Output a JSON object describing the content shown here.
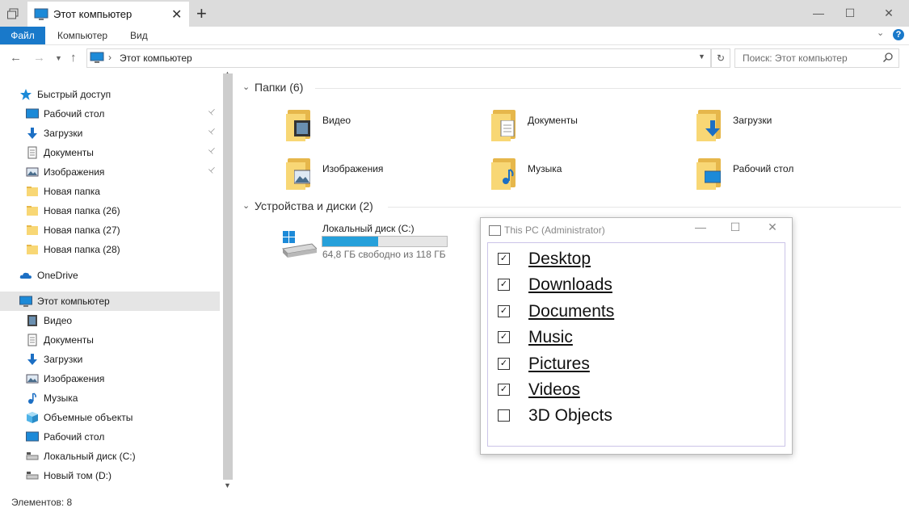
{
  "window": {
    "tab_title": "Этот компьютер",
    "new_tab": "+",
    "minimize": "—",
    "maximize": "☐",
    "close": "✕"
  },
  "ribbon": {
    "file": "Файл",
    "computer": "Компьютер",
    "view": "Вид",
    "help": "?",
    "collapse": "⌄"
  },
  "address": {
    "path": "Этот компьютер",
    "separator": "›",
    "search_placeholder": "Поиск: Этот компьютер"
  },
  "nav_pane": {
    "quick_access": "Быстрый доступ",
    "quick_items": [
      {
        "label": "Рабочий стол",
        "icon": "desktop-icon",
        "pinned": true
      },
      {
        "label": "Загрузки",
        "icon": "downloads-icon",
        "pinned": true
      },
      {
        "label": "Документы",
        "icon": "documents-icon",
        "pinned": true
      },
      {
        "label": "Изображения",
        "icon": "pictures-icon",
        "pinned": true
      },
      {
        "label": "Новая папка",
        "icon": "folder-icon",
        "pinned": false
      },
      {
        "label": "Новая папка (26)",
        "icon": "folder-icon",
        "pinned": false
      },
      {
        "label": "Новая папка (27)",
        "icon": "folder-icon",
        "pinned": false
      },
      {
        "label": "Новая папка (28)",
        "icon": "folder-icon",
        "pinned": false
      }
    ],
    "onedrive": "OneDrive",
    "this_pc": "Этот компьютер",
    "pc_items": [
      {
        "label": "Видео",
        "icon": "video-icon"
      },
      {
        "label": "Документы",
        "icon": "documents-icon"
      },
      {
        "label": "Загрузки",
        "icon": "downloads-icon"
      },
      {
        "label": "Изображения",
        "icon": "pictures-icon"
      },
      {
        "label": "Музыка",
        "icon": "music-icon"
      },
      {
        "label": "Объемные объекты",
        "icon": "3d-objects-icon"
      },
      {
        "label": "Рабочий стол",
        "icon": "desktop-icon"
      },
      {
        "label": "Локальный диск (C:)",
        "icon": "drive-icon"
      },
      {
        "label": "Новый том (D:)",
        "icon": "drive-icon"
      }
    ]
  },
  "content": {
    "folders_header": "Папки (6)",
    "folders": [
      {
        "label": "Видео",
        "icon": "video-folder-icon"
      },
      {
        "label": "Документы",
        "icon": "documents-folder-icon"
      },
      {
        "label": "Загрузки",
        "icon": "downloads-folder-icon"
      },
      {
        "label": "Изображения",
        "icon": "pictures-folder-icon"
      },
      {
        "label": "Музыка",
        "icon": "music-folder-icon"
      },
      {
        "label": "Рабочий стол",
        "icon": "desktop-folder-icon"
      }
    ],
    "devices_header": "Устройства и диски (2)",
    "drive": {
      "label": "Локальный диск (C:)",
      "free": "64,8 ГБ свободно из 118 ГБ",
      "used_fraction": 0.45
    }
  },
  "status": {
    "items": "Элементов: 8"
  },
  "dialog": {
    "title": "This PC (Administrator)",
    "options": [
      {
        "label": "Desktop",
        "checked": true
      },
      {
        "label": "Downloads",
        "checked": true
      },
      {
        "label": "Documents",
        "checked": true
      },
      {
        "label": "Music",
        "checked": true
      },
      {
        "label": "Pictures",
        "checked": true
      },
      {
        "label": "Videos",
        "checked": true
      },
      {
        "label": "3D Objects",
        "checked": false
      }
    ]
  },
  "colors": {
    "accent": "#1979ca",
    "folder": "#f8d775",
    "progress": "#26a0da"
  }
}
